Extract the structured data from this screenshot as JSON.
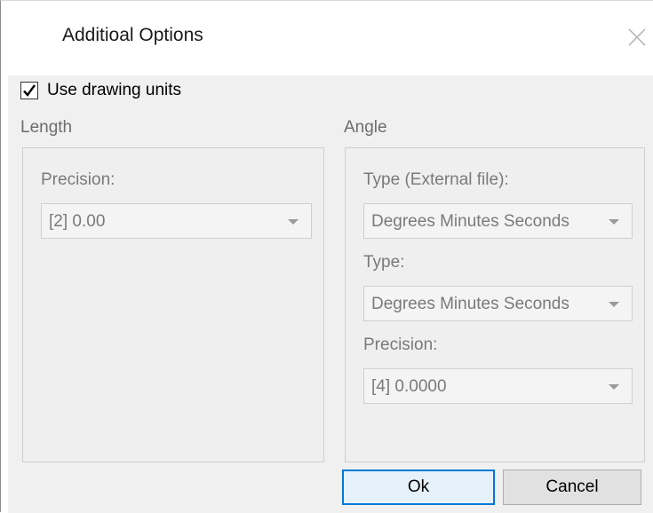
{
  "dialog": {
    "title": "Additioal Options",
    "close_icon": "close-icon"
  },
  "use_drawing_units": {
    "label": "Use drawing units",
    "checked": true
  },
  "length": {
    "group_label": "Length",
    "precision_label": "Precision:",
    "precision_value": "[2] 0.00"
  },
  "angle": {
    "group_label": "Angle",
    "type_external_label": "Type (External file):",
    "type_external_value": "Degrees Minutes Seconds",
    "type_label": "Type:",
    "type_value": "Degrees Minutes Seconds",
    "precision_label": "Precision:",
    "precision_value": "[4] 0.0000"
  },
  "buttons": {
    "ok": "Ok",
    "cancel": "Cancel"
  }
}
